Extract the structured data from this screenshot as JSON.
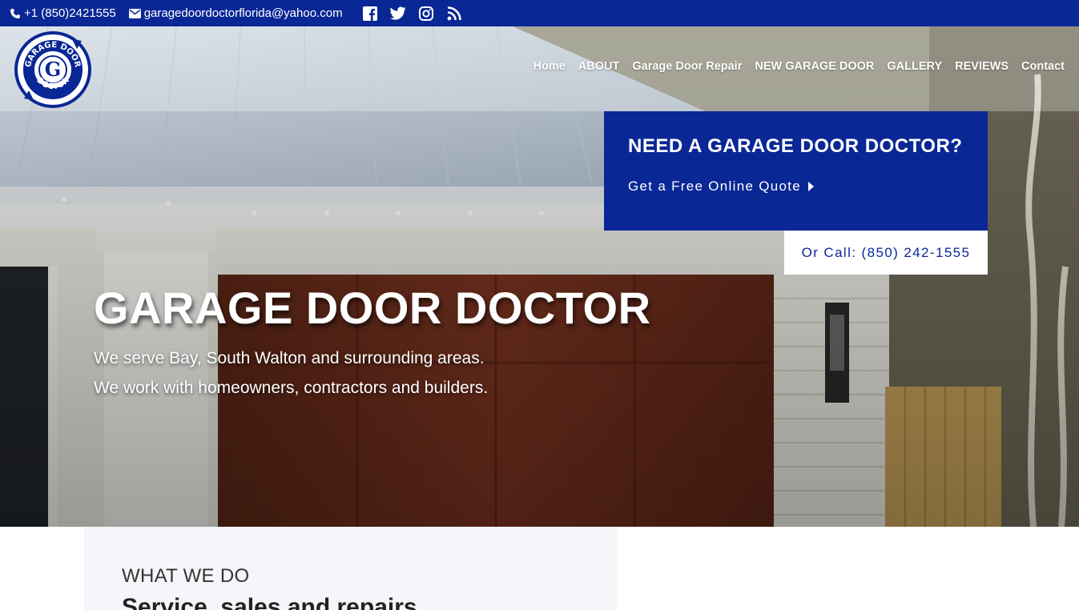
{
  "topbar": {
    "phone": "+1 (850)2421555",
    "email": "garagedoordoctorflorida@yahoo.com",
    "phone_icon": "phone-icon",
    "email_icon": "envelope-icon",
    "social": [
      "facebook-icon",
      "twitter-icon",
      "instagram-icon",
      "rss-icon"
    ]
  },
  "logo": {
    "text_top": "GARAGE DOOR",
    "text_bottom": "DOCTOR",
    "letter": "G"
  },
  "nav": {
    "items": [
      "Home",
      "ABOUT",
      "Garage Door Repair",
      "NEW GARAGE DOOR",
      "GALLERY",
      "REVIEWS",
      "Contact"
    ]
  },
  "cta": {
    "title": "NEED A GARAGE DOOR DOCTOR?",
    "link": "Get a Free Online Quote",
    "call": "Or Call: (850) 242-1555"
  },
  "hero": {
    "title": "GARAGE DOOR DOCTOR",
    "line1": "We serve Bay, South Walton and surrounding areas.",
    "line2": "We work with homeowners, contractors and builders."
  },
  "section": {
    "eyebrow": "WHAT WE DO",
    "heading": "Service, sales and repairs"
  },
  "colors": {
    "brand_blue": "#0a2796",
    "white": "#ffffff"
  }
}
